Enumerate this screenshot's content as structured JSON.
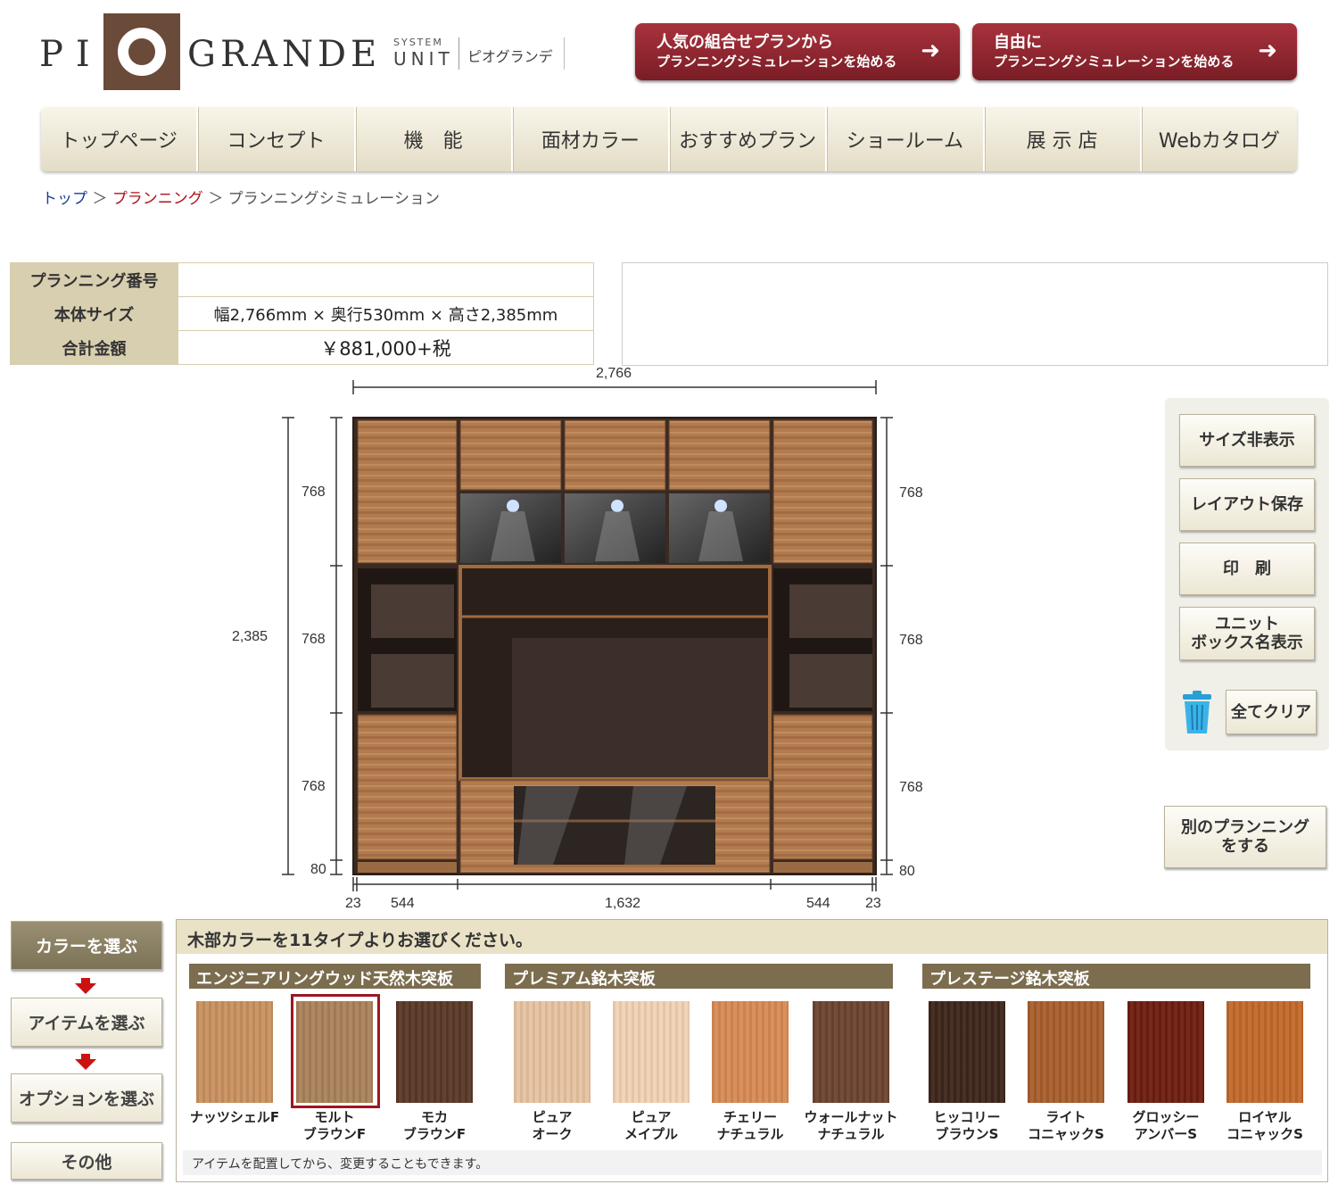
{
  "header": {
    "logo_left": "PI",
    "logo_right": "GRANDE",
    "system": "SYSTEM",
    "unit": "UNIT",
    "brand_kana": "ピオグランデ",
    "cta1_line1": "人気の組合せプランから",
    "cta1_line2": "プランニングシミュレーションを始める",
    "cta2_line1": "自由に",
    "cta2_line2": "プランニングシミュレーションを始める",
    "arrow": "➜"
  },
  "nav": [
    "トップページ",
    "コンセプト",
    "機　能",
    "面材カラー",
    "おすすめプラン",
    "ショールーム",
    "展 示 店",
    "Webカタログ"
  ],
  "breadcrumb": {
    "top": "トップ",
    "sep": "＞",
    "planning": "プランニング",
    "current": "プランニングシミュレーション"
  },
  "info": {
    "number_label": "プランニング番号",
    "number_value": "",
    "size_label": "本体サイズ",
    "size_value": "幅2,766mm × 奥行530mm × 高さ2,385mm",
    "price_label": "合計金額",
    "price_value": "￥881,000+税"
  },
  "dimensions": {
    "total_width": "2,766",
    "total_height": "2,385",
    "row_height": "768",
    "base_height": "80",
    "side_left": "23",
    "side_right": "23",
    "col_left": "544",
    "col_center": "1,632",
    "col_right": "544"
  },
  "side_buttons": {
    "size_toggle": "サイズ非表示",
    "save_layout": "レイアウト保存",
    "print": "印　刷",
    "unit_line1": "ユニット",
    "unit_line2": "ボックス名表示",
    "clear_all": "全てクリア",
    "other_line1": "別のプランニング",
    "other_line2": "をする"
  },
  "steps": {
    "color": "カラーを選ぶ",
    "item": "アイテムを選ぶ",
    "option": "オプションを選ぶ",
    "other": "その他"
  },
  "color_panel": {
    "heading": "木部カラーを11タイプよりお選びください。",
    "categories": [
      "エンジニアリングウッド天然木突板",
      "プレミアム銘木突板",
      "プレステージ銘木突板"
    ],
    "swatches": [
      {
        "line1": "ナッツシェルF",
        "line2": "",
        "color": "#c9915f"
      },
      {
        "line1": "モルト",
        "line2": "ブラウンF",
        "color": "#a9825a"
      },
      {
        "line1": "モカ",
        "line2": "ブラウンF",
        "color": "#5a3826"
      },
      {
        "line1": "ピュア",
        "line2": "オーク",
        "color": "#e7c3a0"
      },
      {
        "line1": "ピュア",
        "line2": "メイプル",
        "color": "#f1d2b5"
      },
      {
        "line1": "チェリー",
        "line2": "ナチュラル",
        "color": "#d78a53"
      },
      {
        "line1": "ウォールナット",
        "line2": "ナチュラル",
        "color": "#6c4330"
      },
      {
        "line1": "ヒッコリー",
        "line2": "ブラウンS",
        "color": "#3d2519"
      },
      {
        "line1": "ライト",
        "line2": "コニャックS",
        "color": "#a85e2c"
      },
      {
        "line1": "グロッシー",
        "line2": "アンバーS",
        "color": "#6e1e10"
      },
      {
        "line1": "ロイヤル",
        "line2": "コニャックS",
        "color": "#c2692b"
      }
    ],
    "note": "アイテムを配置してから、変更することもできます。"
  }
}
